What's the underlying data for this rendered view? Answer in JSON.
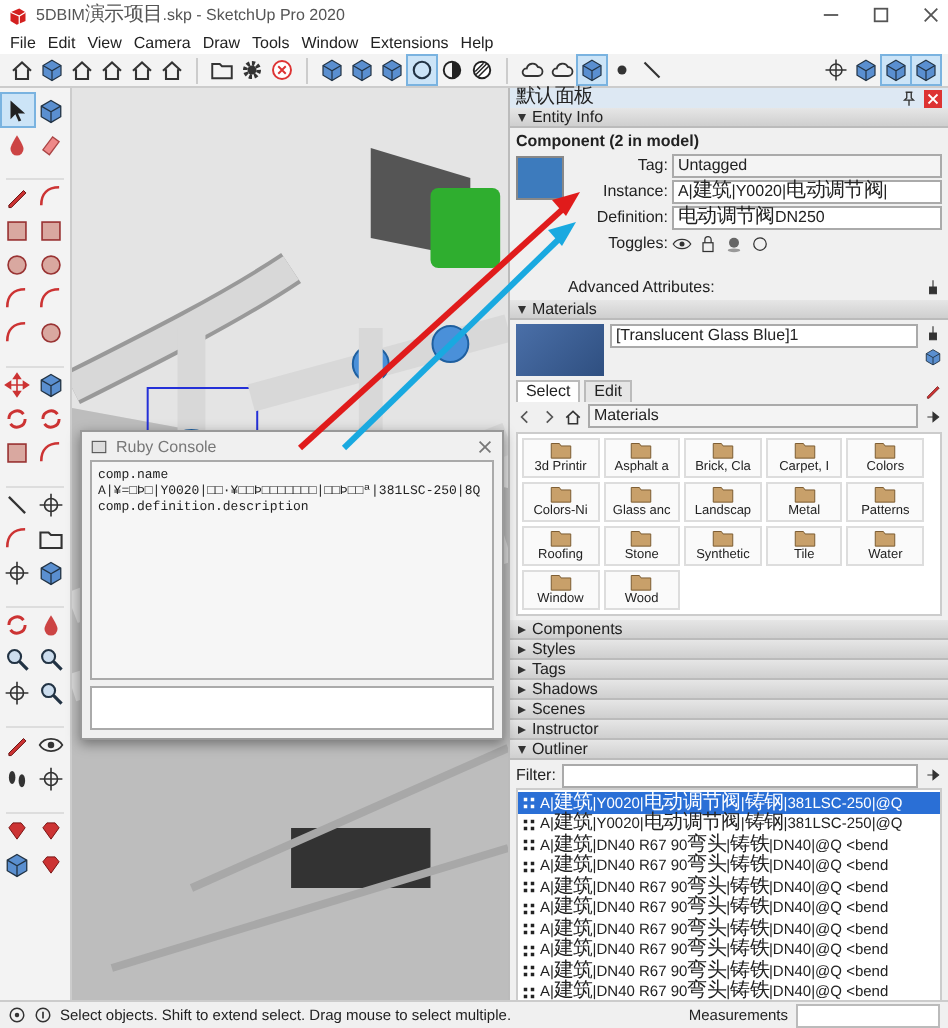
{
  "window": {
    "title": "5DBIM演示项目.skp - SketchUp Pro 2020"
  },
  "menu": [
    "File",
    "Edit",
    "View",
    "Camera",
    "Draw",
    "Tools",
    "Window",
    "Extensions",
    "Help"
  ],
  "toolbar": [
    {
      "selected": false
    },
    {
      "selected": false
    },
    {
      "selected": false
    },
    {
      "selected": false
    },
    {
      "selected": false
    },
    {
      "selected": false
    },
    {
      "selected": false
    },
    {
      "selected": false
    },
    {
      "selected": false
    },
    {
      "selected": false
    },
    {
      "selected": false
    },
    {
      "selected": false
    },
    {
      "selected": true
    },
    {
      "selected": false
    },
    {
      "selected": false
    },
    {
      "selected": false
    },
    {
      "selected": false
    },
    {
      "selected": true
    },
    {
      "selected": false
    },
    {
      "selected": false
    },
    {
      "selected": false
    },
    {
      "selected": false
    },
    {
      "selected": true
    },
    {
      "selected": true
    }
  ],
  "tool_palette": [
    {
      "selected": true
    },
    {
      "selected": false
    },
    {
      "selected": false
    },
    {
      "selected": false
    },
    {
      "selected": false
    },
    {
      "selected": false
    },
    {
      "selected": false
    },
    {
      "selected": false
    },
    {
      "selected": false
    },
    {
      "selected": false
    },
    {
      "selected": false
    },
    {
      "selected": false
    },
    {
      "selected": false
    },
    {
      "selected": false
    },
    {
      "selected": false
    },
    {
      "selected": false
    },
    {
      "selected": false
    },
    {
      "selected": false
    },
    {
      "selected": false
    },
    {
      "selected": false
    },
    {
      "selected": false
    },
    {
      "selected": false
    },
    {
      "selected": false
    },
    {
      "selected": false
    },
    {
      "selected": false
    },
    {
      "selected": false
    },
    {
      "selected": false
    },
    {
      "selected": false
    },
    {
      "selected": false
    },
    {
      "selected": false
    },
    {
      "selected": false
    },
    {
      "selected": false
    },
    {
      "selected": false
    },
    {
      "selected": false
    },
    {
      "selected": false
    },
    {
      "selected": false
    },
    {
      "selected": false
    },
    {
      "selected": false
    },
    {
      "selected": false
    },
    {
      "selected": false
    }
  ],
  "ruby_console": {
    "title": "Ruby Console",
    "output": [
      "comp.name",
      "A|¥=□Þ□|Y0020|□□·¥□□Þ□□□□□□□|□□Þ□□ª|381LSC-250|8Q",
      "comp.definition.description"
    ]
  },
  "tray": {
    "title": "默认面板",
    "entity_info": {
      "header": "Entity Info",
      "expanded": true,
      "heading": "Component (2 in model)",
      "tag_label": "Tag:",
      "tag": "Untagged",
      "instance_label": "Instance:",
      "instance": "A|建筑|Y0020|电动调节阀|",
      "definition_label": "Definition:",
      "definition": "电动调节阀DN250",
      "toggles_label": "Toggles:",
      "advanced": "Advanced Attributes:"
    },
    "materials": {
      "header": "Materials",
      "expanded": true,
      "name": "[Translucent Glass Blue]1",
      "tabs": [
        {
          "label": "Select",
          "selected": true
        },
        {
          "label": "Edit",
          "selected": false
        }
      ],
      "collection": "Materials",
      "items": [
        "3d Printir",
        "Asphalt a",
        "Brick, Cla",
        "Carpet, I",
        "Colors",
        "Colors-Ni",
        "Glass anc",
        "Landscap",
        "Metal",
        "Patterns",
        "Roofing",
        "Stone",
        "Synthetic",
        "Tile",
        "Water",
        "Window",
        "Wood"
      ]
    },
    "panels": [
      {
        "header": "Components",
        "expanded": false
      },
      {
        "header": "Styles",
        "expanded": false
      },
      {
        "header": "Tags",
        "expanded": false
      },
      {
        "header": "Shadows",
        "expanded": false
      },
      {
        "header": "Scenes",
        "expanded": false
      },
      {
        "header": "Instructor",
        "expanded": false
      }
    ],
    "outliner": {
      "header": "Outliner",
      "expanded": true,
      "filter_label": "Filter:",
      "rows": [
        {
          "label": "A|建筑|Y0020|电动调节阀|铸钢|381LSC-250|@Q",
          "selected": true
        },
        {
          "label": "A|建筑|Y0020|电动调节阀|铸钢|381LSC-250|@Q",
          "selected": false
        },
        {
          "label": "A|建筑|DN40 R67 90弯头|铸铁|DN40|@Q <bend",
          "selected": false
        },
        {
          "label": "A|建筑|DN40 R67 90弯头|铸铁|DN40|@Q <bend",
          "selected": false
        },
        {
          "label": "A|建筑|DN40 R67 90弯头|铸铁|DN40|@Q <bend",
          "selected": false
        },
        {
          "label": "A|建筑|DN40 R67 90弯头|铸铁|DN40|@Q <bend",
          "selected": false
        },
        {
          "label": "A|建筑|DN40 R67 90弯头|铸铁|DN40|@Q <bend",
          "selected": false
        },
        {
          "label": "A|建筑|DN40 R67 90弯头|铸铁|DN40|@Q <bend",
          "selected": false
        },
        {
          "label": "A|建筑|DN40 R67 90弯头|铸铁|DN40|@Q <bend",
          "selected": false
        },
        {
          "label": "A|建筑|DN40 R67 90弯头|铸铁|DN40|@Q <bend",
          "selected": false
        }
      ]
    }
  },
  "status_bar": {
    "message": "Select objects. Shift to extend select. Drag mouse to select multiple.",
    "measurements_label": "Measurements"
  }
}
